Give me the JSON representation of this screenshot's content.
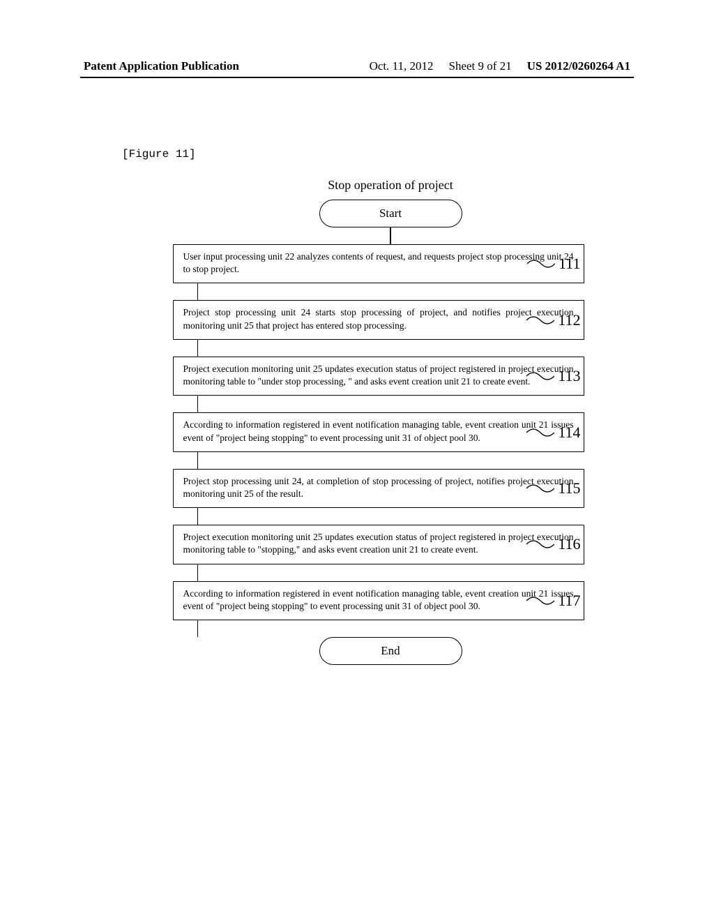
{
  "header": {
    "publication_label": "Patent Application Publication",
    "date": "Oct. 11, 2012",
    "sheet": "Sheet 9 of 21",
    "pub_number": "US 2012/0260264 A1"
  },
  "figure_label": "[Figure 11]",
  "chart_data": {
    "type": "flowchart",
    "title": "Stop operation of project",
    "start": "Start",
    "end": "End",
    "steps": [
      {
        "num": "111",
        "text": "User input processing unit 22 analyzes contents of request, and requests project stop processing unit 24 to stop project."
      },
      {
        "num": "112",
        "text": "Project stop processing unit 24 starts stop processing of project, and notifies project execution monitoring unit 25 that project has entered stop processing."
      },
      {
        "num": "113",
        "text": "Project execution monitoring unit 25 updates execution status of project registered in project execution monitoring table to \"under stop processing, \" and asks event creation unit 21 to create event."
      },
      {
        "num": "114",
        "text": "According to information registered in event notification managing table, event creation unit 21 issues event of \"project being stopping\" to event processing unit 31 of object pool 30."
      },
      {
        "num": "115",
        "text": "Project stop processing unit 24, at completion of stop processing of project, notifies project execution monitoring unit 25 of the result."
      },
      {
        "num": "116",
        "text": "Project execution monitoring unit 25 updates execution status of project registered in project execution monitoring table to \"stopping,\" and asks event creation unit 21 to create event."
      },
      {
        "num": "117",
        "text": "According to information registered in event notification managing table, event creation unit 21 issues event of \"project being stopping\" to event processing unit 31 of object pool 30."
      }
    ]
  }
}
